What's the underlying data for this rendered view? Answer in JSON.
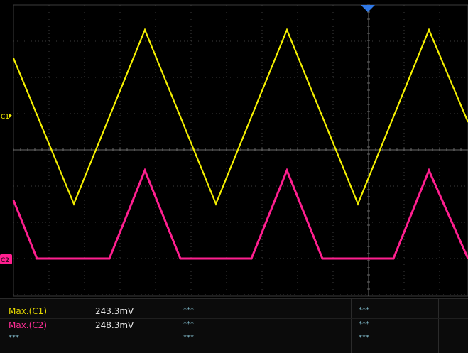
{
  "screen": {
    "channel1_marker": "C1",
    "channel2_marker": "C2",
    "channel1_color": "#f5f000",
    "channel2_color": "#ff1f8f",
    "grid_color": "#3c3c3c",
    "background": "#000000",
    "trigger_marker_icon": "triangle-down-icon",
    "trigger_color": "#2f78e6"
  },
  "measurements": [
    {
      "label": "Max.(C1)",
      "value": "243.3mV",
      "slot2": "***",
      "slot3": "***",
      "color": "#e6d800"
    },
    {
      "label": "Max.(C2)",
      "value": "248.3mV",
      "slot2": "***",
      "slot3": "***",
      "color": "#ff2f96"
    },
    {
      "label": "***",
      "value": "",
      "slot2": "***",
      "slot3": "***",
      "color": "#7fb8c8"
    }
  ]
}
